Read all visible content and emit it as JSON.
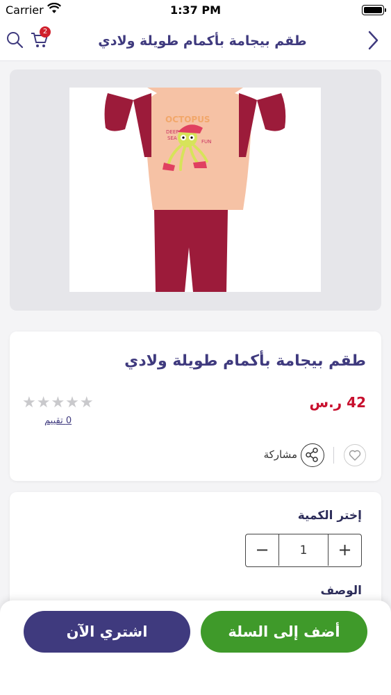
{
  "status_bar": {
    "carrier": "Carrier",
    "time": "1:37 PM"
  },
  "nav": {
    "title": "طقم بيجامة بأكمام طويلة ولادي",
    "cart_count": "2"
  },
  "product": {
    "title": "طقم بيجامة بأكمام طويلة ولادي",
    "price": "42 ر.س",
    "stars": "★★★★★",
    "rating_value": 0,
    "ratings_text": "0 تقييم",
    "share_label": "مشاركة",
    "image_text": {
      "line1": "OCTOPUS",
      "line2": "DEEP",
      "line3": "SEA",
      "line4": "FUN"
    }
  },
  "quantity": {
    "label": "إختر الكمية",
    "value": "1",
    "plus": "+",
    "minus": "−"
  },
  "description": {
    "label": "الوصف"
  },
  "actions": {
    "add_to_cart": "أضف إلى السلة",
    "buy_now": "اشتري الآن"
  },
  "colors": {
    "brand_purple": "#3f3a7e",
    "price_red": "#c8102e",
    "cart_green": "#3f9a2a",
    "badge_red": "#d0202c"
  },
  "icons": [
    "wifi-icon",
    "battery-icon",
    "search-icon",
    "cart-icon",
    "back-chevron-icon",
    "star-icon",
    "heart-icon",
    "share-icon"
  ]
}
